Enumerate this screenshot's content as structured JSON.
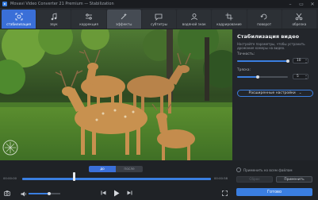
{
  "window": {
    "title": "Movavi Video Converter 21 Premium — Stabilization",
    "controls": [
      "–",
      "▭",
      "✕"
    ]
  },
  "tabs": [
    {
      "label": "стабилизация",
      "icon": "stabilize-icon",
      "active": true
    },
    {
      "label": "звук",
      "icon": "music-note-icon",
      "active": false
    },
    {
      "label": "коррекция",
      "icon": "adjust-sliders-icon",
      "active": false
    },
    {
      "label": "эффекты",
      "icon": "magic-wand-icon",
      "active": false,
      "hover": true
    },
    {
      "label": "субтитры",
      "icon": "speech-bubble-icon",
      "active": false
    },
    {
      "label": "водяной знак",
      "icon": "watermark-person-icon",
      "active": false
    },
    {
      "label": "кадрирование",
      "icon": "crop-icon",
      "active": false
    },
    {
      "label": "поворот",
      "icon": "rotate-icon",
      "active": false
    },
    {
      "label": "обрезка",
      "icon": "scissors-icon",
      "active": false
    }
  ],
  "panel": {
    "title": "Стабилизация видео",
    "description": "Настройте параметры, чтобы устранить дрожание камеры на видео.",
    "params": [
      {
        "label": "Точность:",
        "value": "10",
        "fraction": 1.0
      },
      {
        "label": "Тряска:",
        "value": "5",
        "fraction": 0.4
      }
    ],
    "advanced_label": "Расширенные настройки"
  },
  "player": {
    "mode_before": "до",
    "mode_after": "после",
    "time_start": "00:00:00",
    "time_end": "00:00:58",
    "playhead_fraction": 0.27,
    "volume_fraction": 0.65
  },
  "footer": {
    "apply_all_label": "Применить ко всем файлам",
    "reset_label": "Сброс",
    "apply_label": "Применить",
    "done_label": "Готово"
  },
  "colors": {
    "accent": "#3a7ee0",
    "active_tab": "#3a6fd8"
  }
}
